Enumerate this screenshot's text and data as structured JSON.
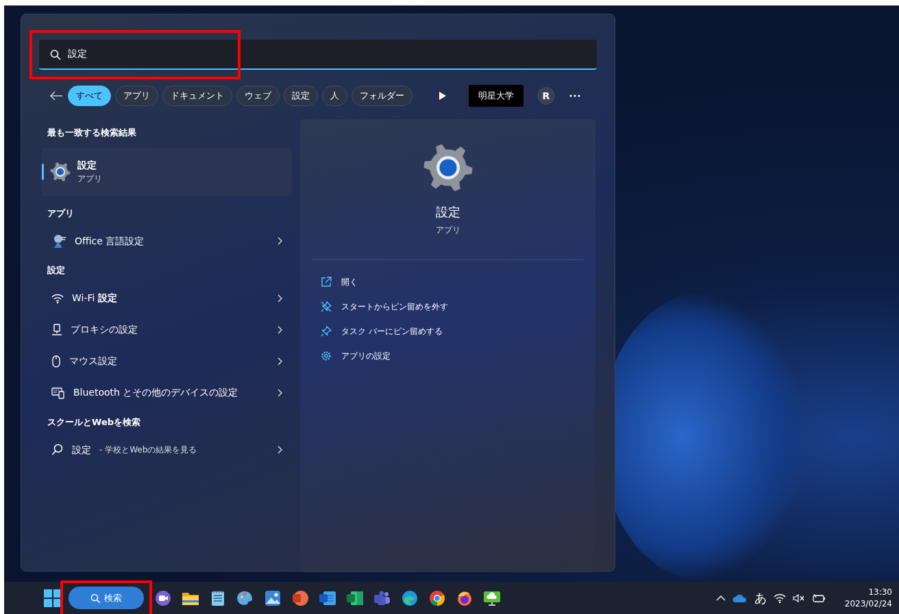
{
  "search": {
    "value": "設定",
    "highlighted": true
  },
  "filters": [
    {
      "label": "すべて",
      "selected": true
    },
    {
      "label": "アプリ",
      "selected": false
    },
    {
      "label": "ドキュメント",
      "selected": false
    },
    {
      "label": "ウェブ",
      "selected": false
    },
    {
      "label": "設定",
      "selected": false
    },
    {
      "label": "人",
      "selected": false
    },
    {
      "label": "フォルダー",
      "selected": false
    }
  ],
  "org_badge": "明星大学",
  "avatar": "R",
  "best_match": {
    "heading": "最も一致する検索結果",
    "title": "設定",
    "subtitle": "アプリ",
    "selected": true
  },
  "sections": [
    {
      "heading": "アプリ",
      "items": [
        {
          "label": "Office 言語設定",
          "kind": "office"
        }
      ]
    },
    {
      "heading": "設定",
      "items": [
        {
          "label": "Wi-Fi **設定**",
          "kind": "wifi"
        },
        {
          "label": "プロキシの設定",
          "kind": "proxy"
        },
        {
          "label": "マウス設定",
          "kind": "mouse"
        },
        {
          "label": "Bluetooth とその他のデバイスの設定",
          "kind": "devices"
        }
      ]
    },
    {
      "heading": "スクールとWebを検索",
      "items": [
        {
          "label": "設定",
          "suffix": "- 学校とWebの結果を見る",
          "kind": "web"
        }
      ]
    }
  ],
  "detail": {
    "title": "設定",
    "subtitle": "アプリ",
    "actions": [
      {
        "label": "開く",
        "kind": "open"
      },
      {
        "label": "スタートからピン留めを外す",
        "kind": "unpin"
      },
      {
        "label": "タスク バーにピン留めする",
        "kind": "pin"
      },
      {
        "label": "アプリの設定",
        "kind": "settings"
      }
    ]
  },
  "taskbar": {
    "search_label": "検索",
    "search_highlighted": true,
    "apps": [
      {
        "kind": "chat"
      },
      {
        "kind": "folder"
      },
      {
        "kind": "notepad"
      },
      {
        "kind": "paint"
      },
      {
        "kind": "photos"
      },
      {
        "kind": "slides"
      },
      {
        "kind": "doc"
      },
      {
        "kind": "sheet"
      },
      {
        "kind": "teams"
      },
      {
        "kind": "edge"
      },
      {
        "kind": "chrome"
      },
      {
        "kind": "firefox"
      },
      {
        "kind": "remote"
      }
    ]
  },
  "tray": {
    "ime": "あ",
    "time": "13:30",
    "date": "2023/02/24"
  }
}
